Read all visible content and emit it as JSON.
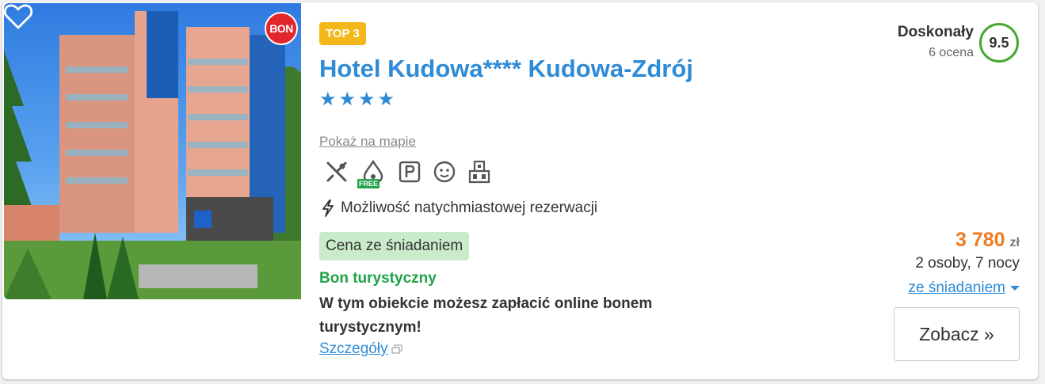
{
  "listing": {
    "photo_badge": "BON",
    "rank_badge": "TOP 3",
    "hotel_name": "Hotel Kudowa**** Kudowa-Zdrój",
    "stars": 4,
    "map_link": "Pokaż na mapie",
    "amenities": [
      "restaurant-icon",
      "water-drop-free-icon",
      "parking-icon",
      "kids-icon",
      "building-icon"
    ],
    "amenity_free_tag": "FREE",
    "instant_booking": "Możliwość natychmiastowej rezerwacji",
    "breakfast_badge": "Cena ze śniadaniem",
    "bon_title": "Bon turystyczny",
    "bon_description": "W tym obiekcie możesz zapłacić online bonem turystycznym!",
    "details_link": "Szczegóły"
  },
  "rating": {
    "label": "Doskonały",
    "count": "6 ocena",
    "score": "9.5"
  },
  "pricing": {
    "amount": "3 780",
    "currency": "zł",
    "occupancy": "2 osoby, 7 nocy",
    "board_option": "ze śniadaniem"
  },
  "cta": {
    "label": "Zobacz »"
  },
  "colors": {
    "brand_blue": "#2f8bd6",
    "price_orange": "#f07a1e",
    "bon_green": "#1fa347",
    "rating_green": "#45a830",
    "top_badge_yellow": "#f4b71a"
  }
}
